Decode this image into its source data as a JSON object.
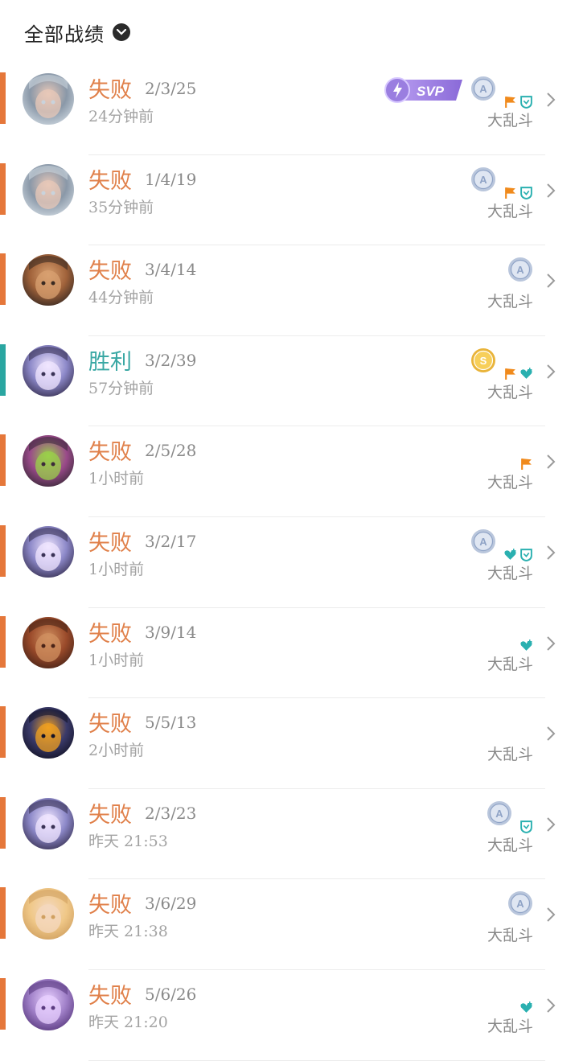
{
  "header": {
    "title": "全部战绩"
  },
  "colors": {
    "loss": "#e5773a",
    "win": "#2aa6a1",
    "loss_text": "#e0804a",
    "win_text": "#3aa8a4"
  },
  "matches": [
    {
      "result": "失败",
      "outcome": "loss",
      "kda": "2/3/25",
      "time": "24分钟前",
      "mode": "大乱斗",
      "svp": "SVP",
      "medal": "A",
      "icons": [
        "flag-icon",
        "shield-icon"
      ],
      "avatar": "champion-silver-hair"
    },
    {
      "result": "失败",
      "outcome": "loss",
      "kda": "1/4/19",
      "time": "35分钟前",
      "mode": "大乱斗",
      "svp": "",
      "medal": "A",
      "icons": [
        "flag-icon",
        "shield-icon"
      ],
      "avatar": "champion-silver-hair"
    },
    {
      "result": "失败",
      "outcome": "loss",
      "kda": "3/4/14",
      "time": "44分钟前",
      "mode": "大乱斗",
      "svp": "",
      "medal": "A",
      "icons": [],
      "avatar": "champion-boy"
    },
    {
      "result": "胜利",
      "outcome": "win",
      "kda": "3/2/39",
      "time": "57分钟前",
      "mode": "大乱斗",
      "svp": "",
      "medal": "S",
      "icons": [
        "flag-icon",
        "heart-icon"
      ],
      "avatar": "champion-yordle-cat"
    },
    {
      "result": "失败",
      "outcome": "loss",
      "kda": "2/5/28",
      "time": "1小时前",
      "mode": "大乱斗",
      "svp": "",
      "medal": "",
      "icons": [
        "flag-icon"
      ],
      "avatar": "champion-green-witch"
    },
    {
      "result": "失败",
      "outcome": "loss",
      "kda": "3/2/17",
      "time": "1小时前",
      "mode": "大乱斗",
      "svp": "",
      "medal": "A",
      "icons": [
        "heart-icon",
        "shield-icon"
      ],
      "avatar": "champion-yordle-cat"
    },
    {
      "result": "失败",
      "outcome": "loss",
      "kda": "3/9/14",
      "time": "1小时前",
      "mode": "大乱斗",
      "svp": "",
      "medal": "",
      "icons": [
        "heart-icon"
      ],
      "avatar": "champion-bearded"
    },
    {
      "result": "失败",
      "outcome": "loss",
      "kda": "5/5/13",
      "time": "2小时前",
      "mode": "大乱斗",
      "svp": "",
      "medal": "",
      "icons": [],
      "avatar": "champion-dark-mage"
    },
    {
      "result": "失败",
      "outcome": "loss",
      "kda": "2/3/23",
      "time": "昨天 21:53",
      "mode": "大乱斗",
      "svp": "",
      "medal": "A",
      "icons": [
        "shield-icon"
      ],
      "avatar": "champion-yordle-cat"
    },
    {
      "result": "失败",
      "outcome": "loss",
      "kda": "3/6/29",
      "time": "昨天 21:38",
      "mode": "大乱斗",
      "svp": "",
      "medal": "A",
      "icons": [],
      "avatar": "champion-blonde"
    },
    {
      "result": "失败",
      "outcome": "loss",
      "kda": "5/6/26",
      "time": "昨天 21:20",
      "mode": "大乱斗",
      "svp": "",
      "medal": "",
      "icons": [
        "heart-icon"
      ],
      "avatar": "champion-purple-horned"
    }
  ]
}
